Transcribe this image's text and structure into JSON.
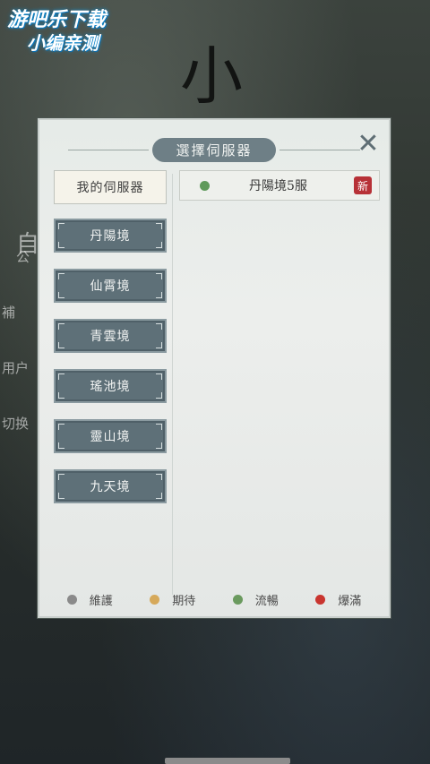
{
  "watermark": {
    "line1": "游吧乐下载",
    "line2": "小编亲测"
  },
  "background": {
    "big_char": "小",
    "side_texts": [
      "自",
      "公",
      "補",
      "用户",
      "切换"
    ]
  },
  "dialog": {
    "title": "選擇伺服器",
    "close_icon": "close-x-icon",
    "my_servers_label": "我的伺服器",
    "regions": [
      "丹陽境",
      "仙霄境",
      "青雲境",
      "瑤池境",
      "靈山境",
      "九天境"
    ],
    "server": {
      "name": "丹陽境5服",
      "status_color": "#5f9a5a",
      "badge": "新"
    },
    "legend": [
      {
        "label": "維護",
        "color": "#8a8a8a"
      },
      {
        "label": "期待",
        "color": "#d6a95a"
      },
      {
        "label": "流暢",
        "color": "#6a9a5e"
      },
      {
        "label": "爆滿",
        "color": "#c9352f"
      }
    ]
  }
}
